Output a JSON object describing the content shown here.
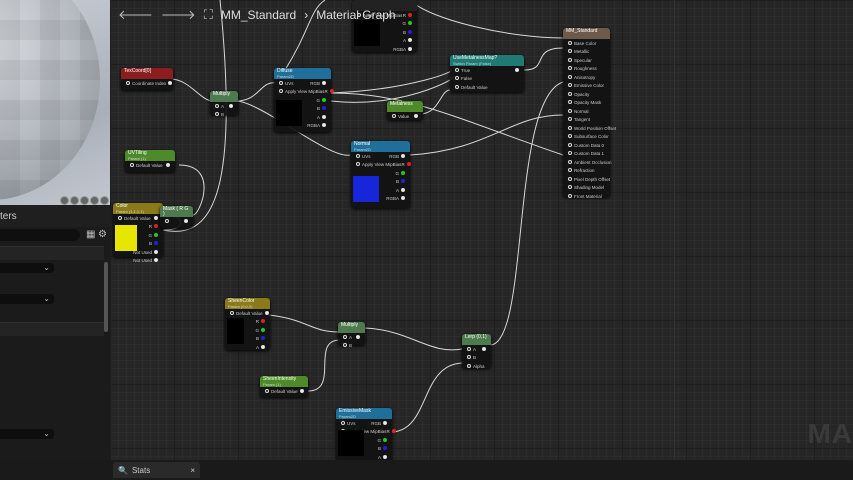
{
  "breadcrumb": {
    "asset": "MM_Standard",
    "graph": "Material Graph"
  },
  "details": {
    "title": "ters",
    "dropdowns": [
      "",
      ""
    ],
    "dropdown3": ""
  },
  "bottom": {
    "stats_label": "Stats",
    "close": "×"
  },
  "watermark": "MA",
  "nodes": {
    "topTex": {
      "title": "",
      "sub": "",
      "color": "#222",
      "in": [
        "Apply View MipBias"
      ],
      "out": [
        "R",
        "G",
        "B",
        "A",
        "RGBA"
      ]
    },
    "texcoord": {
      "title": "TexCoord[0]",
      "sub": "",
      "color": "#8a1e1e",
      "in": [
        "Coordinate Index"
      ],
      "out": [
        ""
      ]
    },
    "mul1": {
      "title": "Multiply",
      "sub": "",
      "color": "#4f7a4f",
      "in": [
        "A",
        "B"
      ],
      "out": [
        ""
      ]
    },
    "diffuse": {
      "title": "Diffuse",
      "sub": "Param2D",
      "color": "#1f6f9a",
      "in": [
        "UVs",
        "Apply View MipBias"
      ],
      "out": [
        "RGB",
        "R",
        "G",
        "B",
        "A",
        "RGBA"
      ]
    },
    "switch": {
      "title": "UseMetalnessMap?",
      "sub": "Switch Param (False)",
      "color": "#1f7a73",
      "in": [
        "True",
        "False",
        "Default Value"
      ],
      "out": [
        ""
      ]
    },
    "scalar": {
      "title": "Metalness",
      "sub": "",
      "color": "#4f8a2a",
      "in": [
        "Value"
      ],
      "out": [
        ""
      ]
    },
    "material": {
      "title": "MM_Standard",
      "sub": "",
      "color": "#6e5a4a",
      "in": [
        "Base Color",
        "Metallic",
        "Specular",
        "Roughness",
        "Anisotropy",
        "Emissive Color",
        "Opacity",
        "Opacity Mask",
        "Normal",
        "Tangent",
        "World Position Offset",
        "Subsurface Color",
        "Custom Data 0",
        "Custom Data 1",
        "Ambient Occlusion",
        "Refraction",
        "Pixel Depth Offset",
        "Shading Model",
        "Front Material"
      ],
      "out": []
    },
    "uvtiling": {
      "title": "UVTiling",
      "sub": "Param (1)",
      "color": "#4f8a2a",
      "in": [
        "Default Value"
      ],
      "out": [
        ""
      ]
    },
    "normal": {
      "title": "Normal",
      "sub": "Param2D",
      "color": "#1f6f9a",
      "in": [
        "UVs",
        "Apply View MipBias"
      ],
      "out": [
        "RGB",
        "R",
        "G",
        "B",
        "A",
        "RGBA"
      ]
    },
    "color": {
      "title": "Color",
      "sub": "Param (1,1,1,1)",
      "color": "#8a7a1a",
      "in": [
        "Default Value"
      ],
      "out": [
        "",
        "R",
        "G",
        "B",
        "Not Used",
        "Not Used"
      ]
    },
    "append": {
      "title": "Mask ( R G )",
      "sub": "",
      "color": "#4f7a4f",
      "in": [
        ""
      ],
      "out": [
        ""
      ]
    },
    "sheencolor": {
      "title": "SheenColor",
      "sub": "Param (0,0,0)",
      "color": "#8a7a1a",
      "in": [
        "Default Value"
      ],
      "out": [
        "",
        "R",
        "G",
        "B",
        "A"
      ]
    },
    "mul2": {
      "title": "Multiply",
      "sub": "",
      "color": "#4f7a4f",
      "in": [
        "A",
        "B"
      ],
      "out": [
        ""
      ]
    },
    "sheenint": {
      "title": "SheenIntensity",
      "sub": "Param (1)",
      "color": "#4f8a2a",
      "in": [
        "Default Value"
      ],
      "out": [
        ""
      ]
    },
    "lerp": {
      "title": "Lerp (0,1)",
      "sub": "",
      "color": "#4f7a4f",
      "in": [
        "A",
        "B",
        "Alpha"
      ],
      "out": [
        ""
      ]
    },
    "emissive": {
      "title": "EmissiveMask",
      "sub": "Param2D",
      "color": "#1f6f9a",
      "in": [
        "UVs",
        "Apply View MipBias"
      ],
      "out": [
        "RGB",
        "R",
        "G",
        "B",
        "A"
      ]
    }
  }
}
